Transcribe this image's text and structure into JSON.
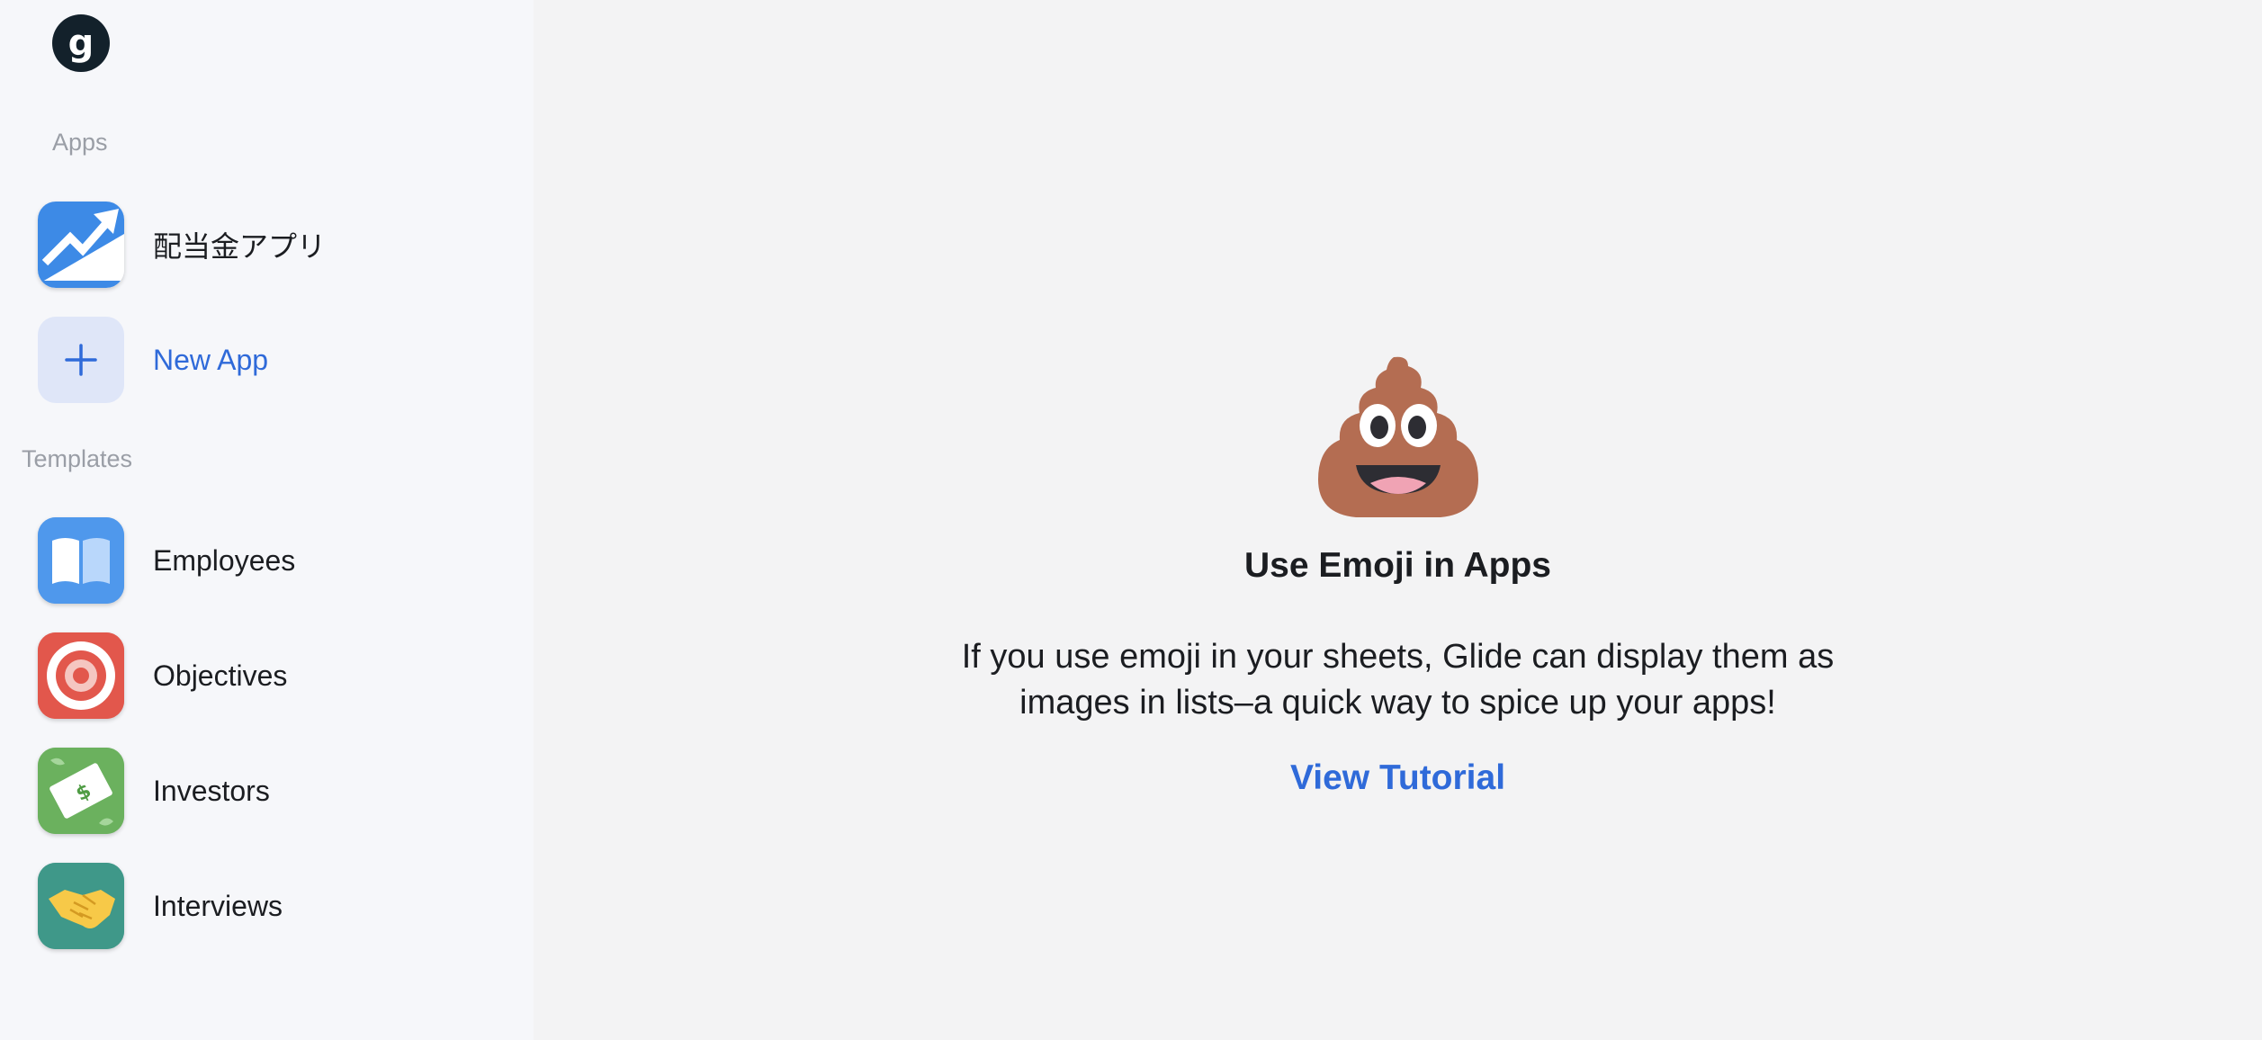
{
  "logo": {
    "letter": "g"
  },
  "sidebar": {
    "apps_label": "Apps",
    "apps": [
      {
        "label": "配当金アプリ",
        "icon": "trend-chart-icon"
      }
    ],
    "new_app_label": "New App",
    "templates_label": "Templates",
    "templates": [
      {
        "label": "Employees",
        "icon": "book-icon",
        "color": "#4f98ec"
      },
      {
        "label": "Objectives",
        "icon": "target-icon",
        "color": "#e2574c"
      },
      {
        "label": "Investors",
        "icon": "money-icon",
        "color": "#6bb15e"
      },
      {
        "label": "Interviews",
        "icon": "handshake-icon",
        "color": "#3f9889"
      }
    ]
  },
  "main": {
    "emoji_icon": "poop-emoji-icon",
    "heading": "Use Emoji in Apps",
    "description": "If you use emoji in your sheets, Glide can display them as images in lists–a quick way to spice up your apps!",
    "tutorial_link": "View Tutorial"
  },
  "colors": {
    "accent": "#2f6ad9",
    "sidebar_bg": "#f6f7fa",
    "main_bg": "#f3f3f4"
  }
}
